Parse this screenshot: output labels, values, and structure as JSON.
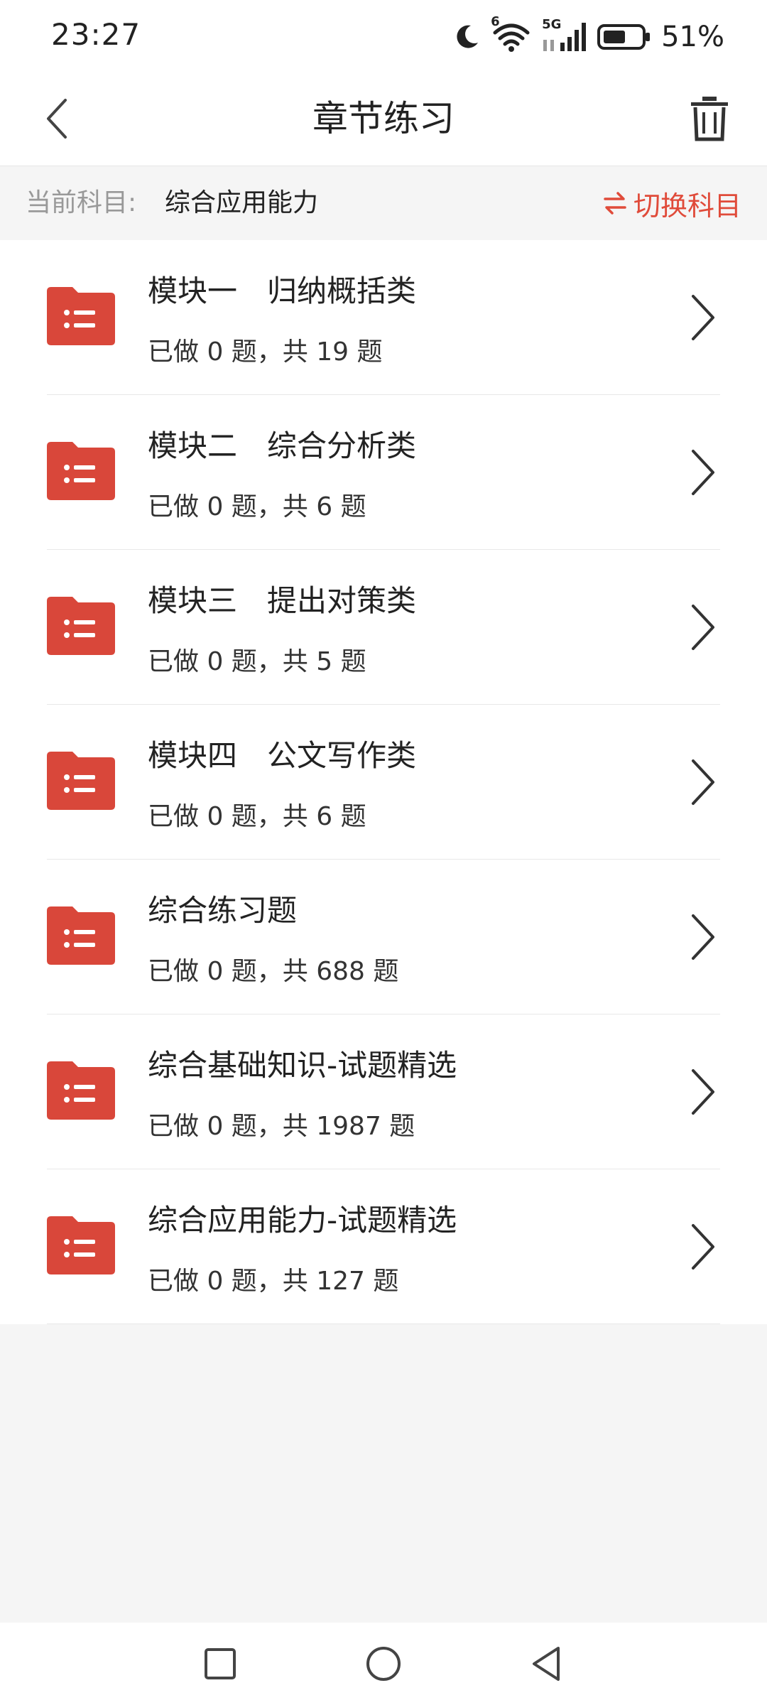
{
  "status": {
    "time": "23:27",
    "battery": "51%",
    "signal_label": "5G",
    "wifi_label": "6"
  },
  "header": {
    "title": "章节练习"
  },
  "subject": {
    "label": "当前科目:",
    "value": "综合应用能力",
    "switch_label": "切换科目"
  },
  "colors": {
    "accent": "#e04b3a",
    "folder": "#d9473a"
  },
  "chapters": [
    {
      "title": "模块一　归纳概括类",
      "progress": "已做 0 题，共 19 题"
    },
    {
      "title": "模块二　综合分析类",
      "progress": "已做 0 题，共 6 题"
    },
    {
      "title": "模块三　提出对策类",
      "progress": "已做 0 题，共 5 题"
    },
    {
      "title": "模块四　公文写作类",
      "progress": "已做 0 题，共 6 题"
    },
    {
      "title": "综合练习题",
      "progress": "已做 0 题，共 688 题"
    },
    {
      "title": "综合基础知识-试题精选",
      "progress": "已做 0 题，共 1987 题"
    },
    {
      "title": "综合应用能力-试题精选",
      "progress": "已做 0 题，共 127 题"
    }
  ]
}
